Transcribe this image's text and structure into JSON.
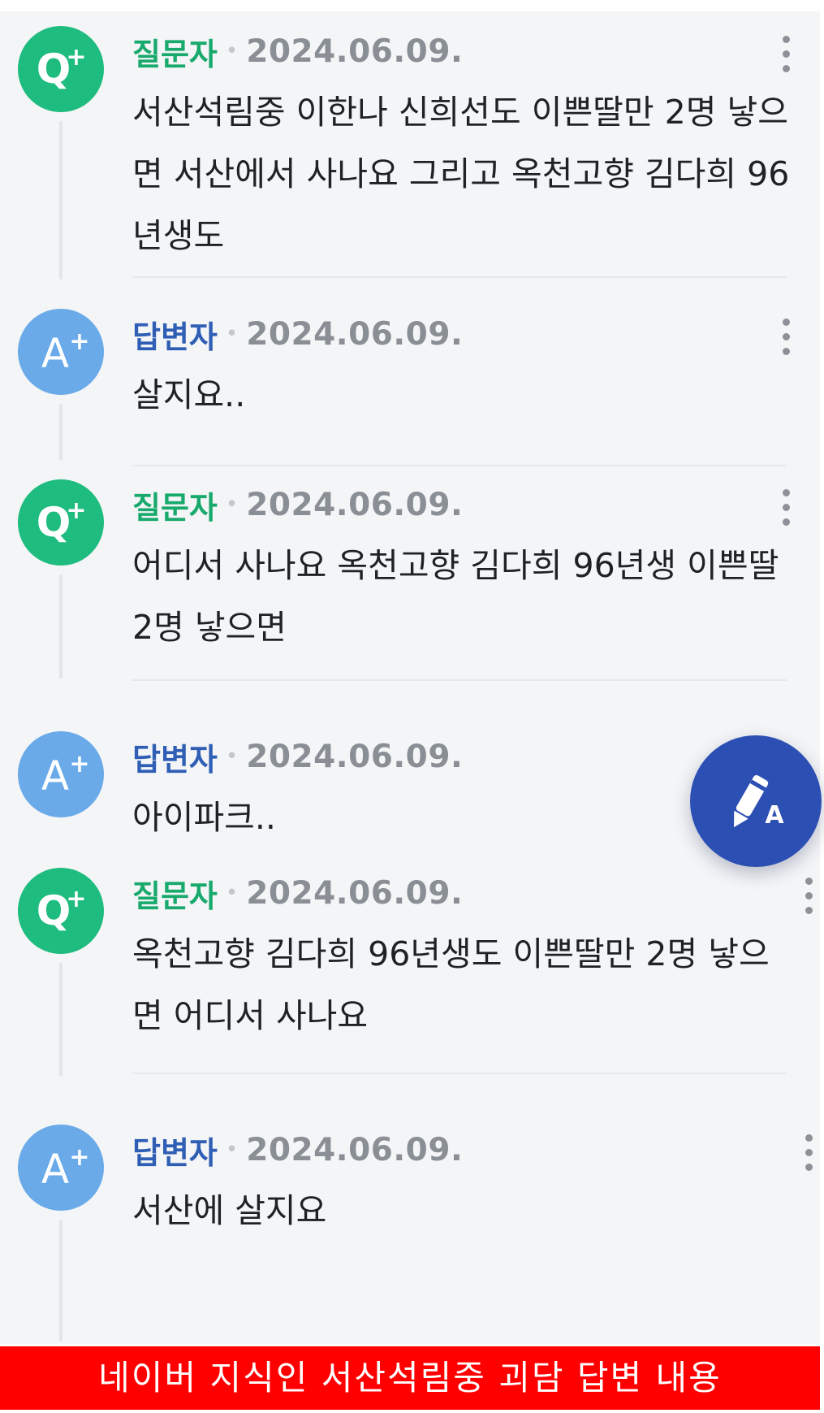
{
  "comments": [
    {
      "role": "질문자",
      "type": "q",
      "date": "2024.06.09.",
      "text": "서산석림중 이한나 신희선도 이쁜딸만 2명 낳으면 서산에서 사나요 그리고 옥천고향 김다희 96년생도"
    },
    {
      "role": "답변자",
      "type": "a",
      "date": "2024.06.09.",
      "text": "살지요.."
    },
    {
      "role": "질문자",
      "type": "q",
      "date": "2024.06.09.",
      "text": "어디서 사나요 옥천고향 김다희 96년생 이쁜딸 2명 낳으면"
    },
    {
      "role": "답변자",
      "type": "a",
      "date": "2024.06.09.",
      "text": "아이파크.."
    },
    {
      "role": "질문자",
      "type": "q",
      "date": "2024.06.09.",
      "text": "옥천고향 김다희 96년생도 이쁜딸만 2명 낳으면 어디서 사나요"
    },
    {
      "role": "답변자",
      "type": "a",
      "date": "2024.06.09.",
      "text": "서산에 살지요"
    }
  ],
  "icons": {
    "question_avatar": "question-plus-icon",
    "answer_avatar": "answer-plus-icon",
    "more": "more-vertical-icon",
    "fab": "write-answer-pencil-icon"
  },
  "colors": {
    "question": "#1ebc7e",
    "answer": "#6aaae9",
    "fab": "#2c4fb3",
    "banner": "#ff0000"
  },
  "banner": {
    "caption": "네이버 지식인 서산석림중 괴담 답변 내용"
  }
}
